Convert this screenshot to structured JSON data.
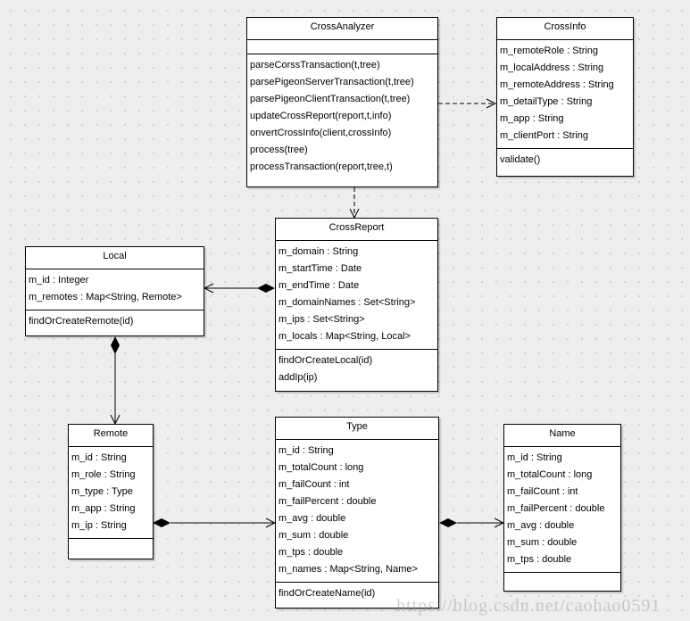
{
  "diagram": {
    "type": "UML class diagram",
    "classes": {
      "crossAnalyzer": {
        "name": "CrossAnalyzer",
        "attributes": [],
        "operations": [
          "parseCorssTransaction(t,tree)",
          "parsePigeonServerTransaction(t,tree)",
          "parsePigeonClientTransaction(t,tree)",
          "updateCrossReport(report,t,info)",
          "onvertCrossInfo(client,crossInfo)",
          "process(tree)",
          "processTransaction(report,tree,t)"
        ]
      },
      "crossInfo": {
        "name": "CrossInfo",
        "attributes": [
          "m_remoteRole : String",
          "m_localAddress : String",
          "m_remoteAddress : String",
          "m_detailType : String",
          "m_app : String",
          "m_clientPort : String"
        ],
        "operations": [
          "validate()"
        ]
      },
      "crossReport": {
        "name": "CrossReport",
        "attributes": [
          "m_domain : String",
          "m_startTime : Date",
          "m_endTime : Date",
          "m_domainNames : Set<String>",
          "m_ips : Set<String>",
          "m_locals : Map<String, Local>"
        ],
        "operations": [
          "findOrCreateLocal(id)",
          "addIp(ip)"
        ]
      },
      "local": {
        "name": "Local",
        "attributes": [
          "m_id : Integer",
          "m_remotes : Map<String, Remote>"
        ],
        "operations": [
          "findOrCreateRemote(id)"
        ]
      },
      "remote": {
        "name": "Remote",
        "attributes": [
          "m_id : String",
          "m_role : String",
          "m_type : Type",
          "m_app : String",
          "m_ip : String"
        ],
        "operations": []
      },
      "type": {
        "name": "Type",
        "attributes": [
          "m_id : String",
          "m_totalCount : long",
          "m_failCount : int",
          "m_failPercent : double",
          "m_avg : double",
          "m_sum : double",
          "m_tps : double",
          "m_names : Map<String, Name>"
        ],
        "operations": [
          "findOrCreateName(id)"
        ]
      },
      "name": {
        "name": "Name",
        "attributes": [
          "m_id : String",
          "m_totalCount : long",
          "m_failCount : int",
          "m_failPercent : double",
          "m_avg : double",
          "m_sum : double",
          "m_tps : double"
        ],
        "operations": []
      }
    },
    "relationships": [
      {
        "from": "CrossAnalyzer",
        "to": "CrossInfo",
        "kind": "dependency"
      },
      {
        "from": "CrossAnalyzer",
        "to": "CrossReport",
        "kind": "dependency"
      },
      {
        "from": "CrossReport",
        "to": "Local",
        "kind": "composition"
      },
      {
        "from": "Local",
        "to": "Remote",
        "kind": "composition"
      },
      {
        "from": "Remote",
        "to": "Type",
        "kind": "composition"
      },
      {
        "from": "Type",
        "to": "Name",
        "kind": "composition"
      }
    ]
  },
  "watermark": "https://blog.csdn.net/caohao0591"
}
